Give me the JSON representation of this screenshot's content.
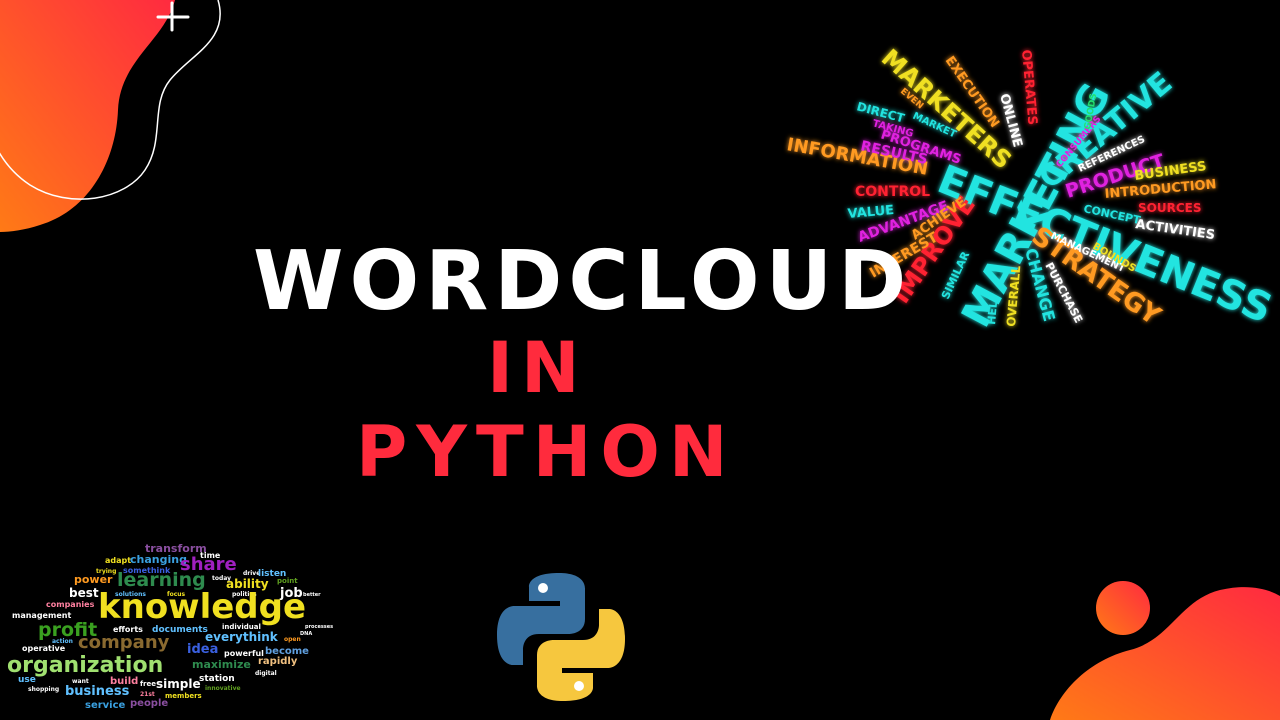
{
  "title": {
    "line1": "WORDCLOUD",
    "line2": "IN",
    "line3": "PYTHON"
  },
  "colors": {
    "background": "#000000",
    "title_white": "#ffffff",
    "title_red": "#ff2b3d",
    "blob_orange": "#ff6a1a",
    "blob_red": "#ff2b3d",
    "python_blue": "#376f9f",
    "python_yellow": "#f6c73e"
  },
  "decorations": {
    "plus_icon": "plus-icon",
    "python_logo": "python-logo-icon"
  },
  "marketing_cloud": {
    "words": [
      "MARKETING",
      "EFFECTIVENESS",
      "CREATIVE",
      "STRATEGY",
      "MARKETERS",
      "IMPROVE",
      "PRODUCT",
      "INFORMATION",
      "EXECUTION",
      "OPERATES",
      "ONLINE",
      "RESULTS",
      "PROGRAMS",
      "CONTROL",
      "VALUE",
      "ADVANTAGE",
      "ACHIEVE",
      "INTEREST",
      "SIMILAR",
      "HELP",
      "OVERALL",
      "CHANGE",
      "PURCHASE",
      "MANAGEMENT",
      "BOUNDS",
      "CONCEPT",
      "ACTIVITIES",
      "SOURCES",
      "INTRODUCTION",
      "BUSINESS",
      "REFERENCES",
      "CONSUMERS",
      "GOODS",
      "DIRECT",
      "MARKET",
      "TAKING",
      "EVEN"
    ]
  },
  "knowledge_cloud": {
    "words": [
      "transform",
      "time",
      "adapt",
      "changing",
      "share",
      "trying",
      "somethink",
      "drive",
      "listen",
      "power",
      "learning",
      "today",
      "ability",
      "point",
      "solutions",
      "focus",
      "politics",
      "job",
      "better",
      "best",
      "companies",
      "knowledge",
      "management",
      "profit",
      "efforts",
      "documents",
      "individual",
      "action",
      "company",
      "everythink",
      "open",
      "operative",
      "idea",
      "powerful",
      "become",
      "organization",
      "maximize",
      "rapidly",
      "use",
      "want",
      "station",
      "digital",
      "build",
      "free",
      "simple",
      "innovative",
      "shopping",
      "business",
      "21st",
      "members",
      "service",
      "people",
      "DNA",
      "processes"
    ]
  }
}
